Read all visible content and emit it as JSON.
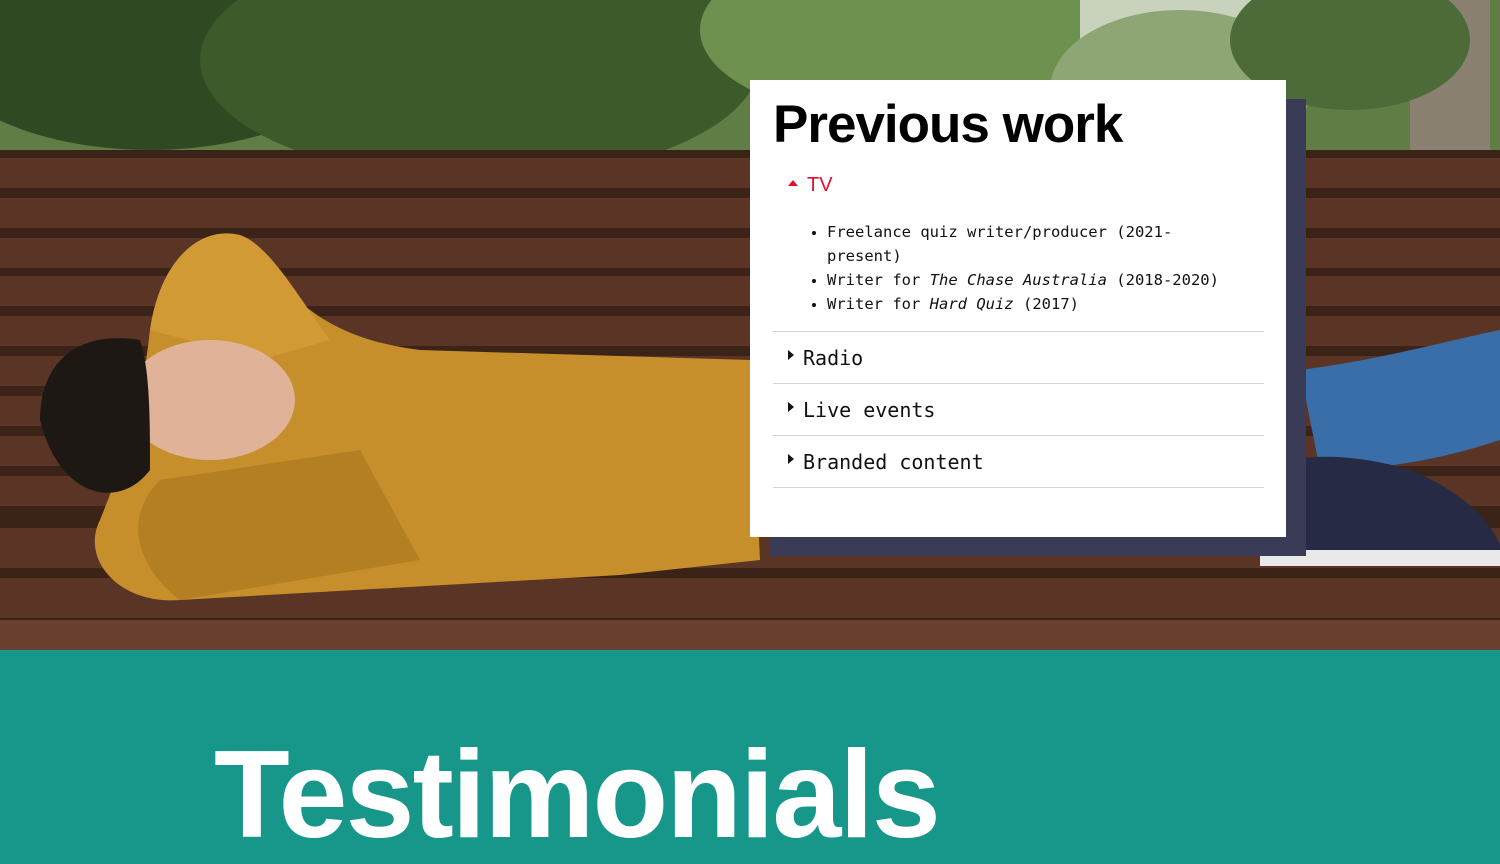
{
  "hero": {
    "image": "person lying on a wooden park bench wearing a mustard sweater"
  },
  "previous_work": {
    "title": "Previous work",
    "sections": [
      {
        "label": "TV",
        "expanded": true,
        "items": [
          {
            "prefix": "Freelance quiz writer/producer (2021-present)",
            "title": "",
            "suffix": ""
          },
          {
            "prefix": "Writer for ",
            "title": "The Chase Australia",
            "suffix": " (2018-2020)"
          },
          {
            "prefix": "Writer for ",
            "title": "Hard Quiz",
            "suffix": " (2017)"
          }
        ]
      },
      {
        "label": "Radio",
        "expanded": false
      },
      {
        "label": "Live events",
        "expanded": false
      },
      {
        "label": "Branded content",
        "expanded": false
      }
    ]
  },
  "testimonials": {
    "title": "Testimonials"
  },
  "colors": {
    "accent_red": "#e0102f",
    "teal_section": "#16978a",
    "card_shadow": "#3a3b57"
  }
}
